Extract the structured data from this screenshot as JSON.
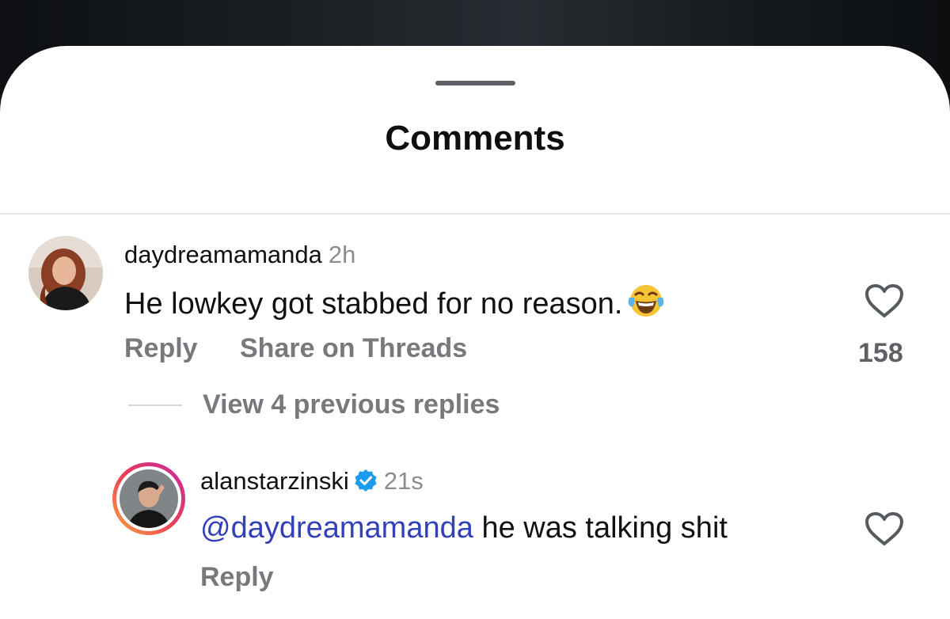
{
  "sheet": {
    "title": "Comments"
  },
  "comments": [
    {
      "username": "daydreamamanda",
      "time": "2h",
      "text": "He lowkey got stabbed for no reason.",
      "emoji": "face-with-tears-of-joy",
      "like_count": "158",
      "actions": {
        "reply": "Reply",
        "share": "Share on Threads"
      }
    }
  ],
  "thread": {
    "view_replies_label": "View 4 previous replies"
  },
  "replies": [
    {
      "username": "alanstarzinski",
      "verified": true,
      "time": "21s",
      "mention": "@daydreamamanda",
      "text": " he was talking shit",
      "actions": {
        "reply": "Reply"
      }
    }
  ],
  "colors": {
    "mention": "#3340b8",
    "verified": "#1d9bf0",
    "secondary_text": "#77797d",
    "story_ring_start": "#f9a73c",
    "story_ring_end": "#d7288f"
  },
  "icons": {
    "heart": "heart-outline-icon",
    "verified": "verified-badge-icon"
  }
}
